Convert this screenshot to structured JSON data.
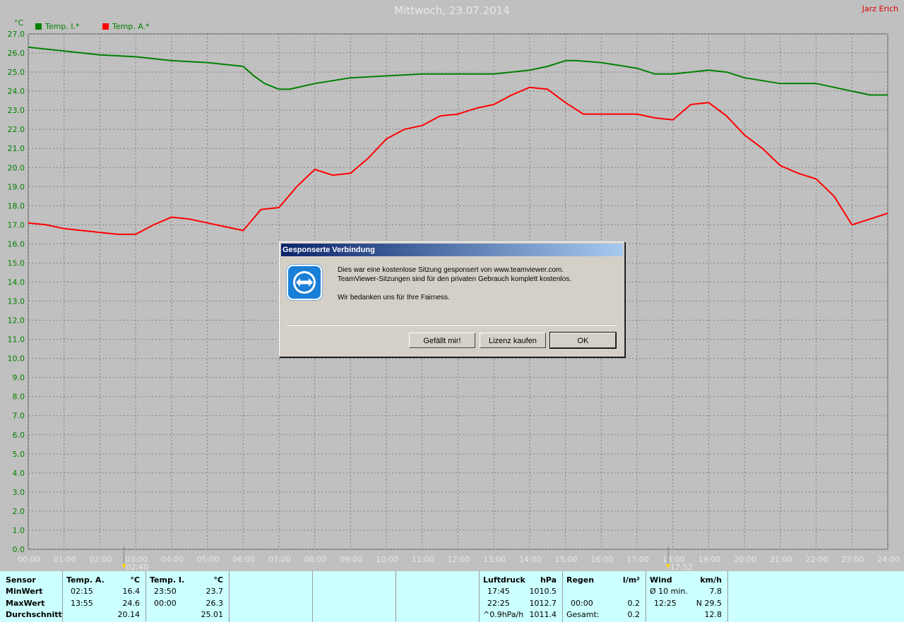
{
  "header": {
    "title": "Mittwoch, 23.07.2014",
    "author": "Jarz Erich",
    "unit": "°C"
  },
  "legend": [
    {
      "label": "Temp. I.*",
      "color": "#008000"
    },
    {
      "label": "Temp. A.*",
      "color": "#ff0000"
    }
  ],
  "chart_data": {
    "type": "line",
    "ylabel": "°C",
    "ylim": [
      0,
      27
    ],
    "yticks": [
      "0.0",
      "1.0",
      "2.0",
      "3.0",
      "4.0",
      "5.0",
      "6.0",
      "7.0",
      "8.0",
      "9.0",
      "10.0",
      "11.0",
      "12.0",
      "13.0",
      "14.0",
      "15.0",
      "16.0",
      "17.0",
      "18.0",
      "19.0",
      "20.0",
      "21.0",
      "22.0",
      "23.0",
      "24.0",
      "25.0",
      "26.0",
      "27.0"
    ],
    "xticks": [
      "00:00",
      "01:00",
      "02:00",
      "03:00",
      "04:00",
      "05:00",
      "06:00",
      "07:00",
      "08:00",
      "09:00",
      "10:00",
      "11:00",
      "12:00",
      "13:00",
      "14:00",
      "15:00",
      "16:00",
      "17:00",
      "18:00",
      "19:00",
      "20:00",
      "21:00",
      "22:00",
      "23:00",
      "24:00"
    ],
    "xlim": [
      0,
      24
    ],
    "grid": true,
    "markers": [
      {
        "label": "02:40",
        "x": 2.67
      },
      {
        "label": "17:52",
        "x": 17.87
      }
    ],
    "series": [
      {
        "name": "Temp. I.*",
        "color": "#008000",
        "x": [
          0,
          1,
          2,
          3,
          4,
          5,
          6,
          6.3,
          6.6,
          7,
          7.3,
          8,
          9,
          10,
          11,
          12,
          13,
          14,
          14.5,
          15,
          15.3,
          16,
          17,
          17.5,
          18,
          18.5,
          19,
          19.5,
          20,
          21,
          22,
          22.5,
          23,
          23.5,
          24
        ],
        "y": [
          26.3,
          26.1,
          25.9,
          25.8,
          25.6,
          25.5,
          25.3,
          24.8,
          24.4,
          24.1,
          24.1,
          24.4,
          24.7,
          24.8,
          24.9,
          24.9,
          24.9,
          25.1,
          25.3,
          25.6,
          25.6,
          25.5,
          25.2,
          24.9,
          24.9,
          25.0,
          25.1,
          25.0,
          24.7,
          24.4,
          24.4,
          24.2,
          24.0,
          23.8,
          23.8
        ]
      },
      {
        "name": "Temp. A.*",
        "color": "#ff0000",
        "x": [
          0,
          0.5,
          1,
          1.5,
          2,
          2.5,
          3,
          3.5,
          4,
          4.5,
          5,
          5.5,
          6,
          6.5,
          7,
          7.5,
          8,
          8.5,
          9,
          9.5,
          10,
          10.5,
          11,
          11.5,
          12,
          12.5,
          13,
          13.5,
          14,
          14.5,
          15,
          15.5,
          16,
          16.5,
          17,
          17.5,
          18,
          18.5,
          19,
          19.5,
          20,
          20.5,
          21,
          21.5,
          22,
          22.5,
          23,
          23.5,
          24
        ],
        "y": [
          17.1,
          17.0,
          16.8,
          16.7,
          16.6,
          16.5,
          16.5,
          17.0,
          17.4,
          17.3,
          17.1,
          16.9,
          16.7,
          17.8,
          17.9,
          19.0,
          19.9,
          19.6,
          19.7,
          20.5,
          21.5,
          22.0,
          22.2,
          22.7,
          22.8,
          23.1,
          23.3,
          23.8,
          24.2,
          24.1,
          23.4,
          22.8,
          22.8,
          22.8,
          22.8,
          22.6,
          22.5,
          23.3,
          23.4,
          22.7,
          21.7,
          21.0,
          20.1,
          19.7,
          19.4,
          18.5,
          17.0,
          17.3,
          17.6
        ]
      }
    ]
  },
  "stats": {
    "sensor": {
      "header": "Sensor",
      "rows": [
        "MinWert",
        "MaxWert",
        "Durchschnitt"
      ]
    },
    "temp_a": {
      "header": "Temp. A.",
      "unit": "°C",
      "min_time": "02:15",
      "min_val": "16.4",
      "max_time": "13:55",
      "max_val": "24.6",
      "avg": "20.14"
    },
    "temp_i": {
      "header": "Temp. I.",
      "unit": "°C",
      "min_time": "23:50",
      "min_val": "23.7",
      "max_time": "00:00",
      "max_val": "26.3",
      "avg": "25.01"
    },
    "pressure": {
      "header": "Luftdruck",
      "unit": "hPa",
      "min_time": "17:45",
      "min_val": "1010.5",
      "max_time": "22:25",
      "max_val": "1012.7",
      "trend_label": "^0.9hPa/h",
      "trend_val": "1011.4"
    },
    "rain": {
      "header": "Regen",
      "unit": "l/m²",
      "max_time": "00:00",
      "max_val": "0.2",
      "total_label": "Gesamt:",
      "total_val": "0.2"
    },
    "wind": {
      "header": "Wind",
      "unit": "km/h",
      "avg_label": "Ø 10 min.",
      "avg_val": "7.8",
      "max_time": "12:25",
      "max_val": "N 29.5",
      "mean_val": "12.8"
    }
  },
  "dialog": {
    "title": "Gesponserte Verbindung",
    "line1": "Dies war eine kostenlose Sitzung gesponsert von www.teamviewer.com.",
    "line2": "TeamViewer-Sitzungen sind für den privaten Gebrauch komplett kostenlos.",
    "line3": "Wir bedanken uns für Ihre Fairness.",
    "btn_like": "Gefällt mir!",
    "btn_buy": "Lizenz kaufen",
    "btn_ok": "OK"
  }
}
